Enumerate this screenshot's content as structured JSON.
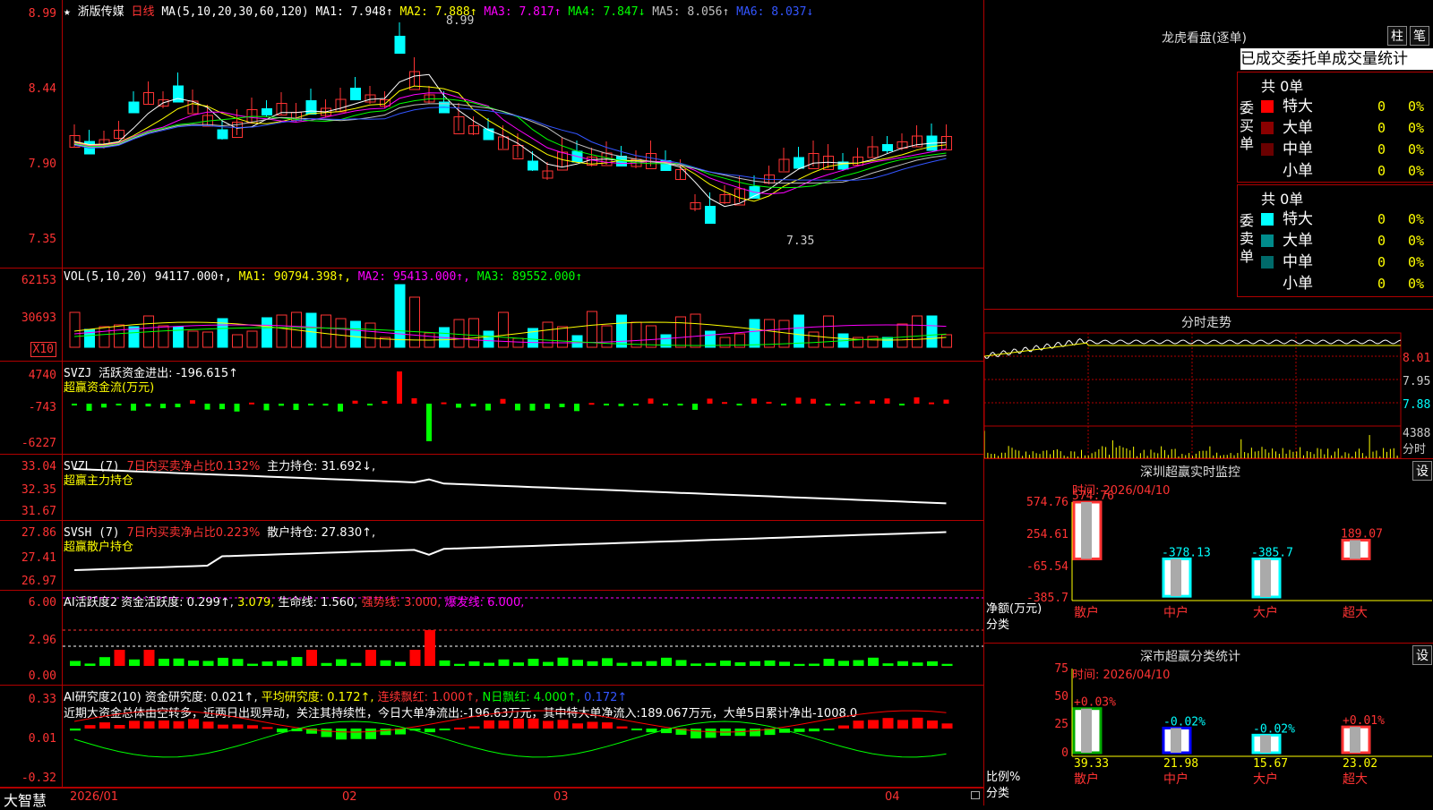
{
  "main": {
    "title_star": "★",
    "stock_name": "浙版传媒",
    "period": "日线",
    "ma_label": "MA(5,10,20,30,60,120)",
    "ma1": "MA1: 7.948↑",
    "ma2": "MA2: 7.888↑",
    "ma3": "MA3: 7.817↑",
    "ma4": "MA4: 7.847↓",
    "ma5": "MA5: 8.056↑",
    "ma6": "MA6: 8.037↓",
    "ticks": [
      "8.99",
      "8.44",
      "7.90",
      "7.35"
    ],
    "high_note": "8.99",
    "low_note": "7.35",
    "colors": {
      "ma1": "#ffffff",
      "ma2": "#ffff00",
      "ma3": "#ff00ff",
      "ma4": "#00ff00",
      "ma5": "#c0c0c0",
      "ma6": "#0000ff",
      "up": "#ff3333",
      "down": "#00ffff"
    }
  },
  "vol": {
    "label": "VOL(5,10,20)",
    "value": "94117.000↑,",
    "ma1": "MA1: 90794.398↑,",
    "ma2": "MA2: 95413.000↑,",
    "ma3": "MA3: 89552.000↑",
    "ticks": [
      "62153",
      "30693"
    ],
    "unit": "X10"
  },
  "svzj": {
    "label": "SVZJ",
    "active": "活跃资金进出: -196.615↑",
    "sub": "超赢资金流(万元)",
    "ticks": [
      "4740",
      "-743",
      "-6227"
    ]
  },
  "svzl": {
    "label": "SVZL (7)",
    "ratio": "7日内买卖净占比0.132%",
    "hold": "主力持仓: 31.692↓,",
    "sub": "超赢主力持仓",
    "ticks": [
      "33.04",
      "32.35",
      "31.67"
    ]
  },
  "svsh": {
    "label": "SVSH (7)",
    "ratio": "7日内买卖净占比0.223%",
    "hold": "散户持仓: 27.830↑,",
    "sub": "超赢散户持仓",
    "ticks": [
      "27.86",
      "27.41",
      "26.97"
    ]
  },
  "ai1": {
    "label": "AI活跃度2",
    "act": "资金活跃度: 0.299↑,",
    "v2": "3.079,",
    "life": "生命线: 1.560,",
    "strong": "强势线: 3.000,",
    "burst": "爆发线: 6.000,",
    "ticks": [
      "6.00",
      "2.96",
      "0.00"
    ]
  },
  "ai2": {
    "label": "AI研究度2(10)",
    "res": "资金研究度: 0.021↑,",
    "avg": "平均研究度: 0.172↑,",
    "cont": "连续飘红: 1.000↑,",
    "nday": "N日飘红: 4.000↑,",
    "last": "0.172↑",
    "comment": "近期大资金总体由空转多，近两日出现异动，关注其持续性，今日大单净流出:-196.63万元，其中特大单净流入:189.067万元，大单5日累计净出-1008.0",
    "ticks": [
      "0.33",
      "0.01",
      "-0.32"
    ]
  },
  "xaxis": {
    "logo": "大智慧",
    "labels": [
      "2026/01",
      "02",
      "03",
      "04"
    ]
  },
  "lhb": {
    "title": "龙虎看盘(逐单)",
    "btn1": "柱",
    "btn2": "笔",
    "tab_text": "已成交委托单成交量统计",
    "buy_label": "委买单",
    "sell_label": "委卖单",
    "buy_total": "共 0单",
    "sell_total": "共 0单",
    "buy_rows": [
      {
        "name": "特大",
        "n": "0",
        "p": "0%",
        "color": "#ff0000"
      },
      {
        "name": "大单",
        "n": "0",
        "p": "0%",
        "color": "#8b0000"
      },
      {
        "name": "中单",
        "n": "0",
        "p": "0%",
        "color": "#6a0000"
      },
      {
        "name": "小单",
        "n": "0",
        "p": "0%",
        "color": "#000000"
      }
    ],
    "sell_rows": [
      {
        "name": "特大",
        "n": "0",
        "p": "0%",
        "color": "#00ffff"
      },
      {
        "name": "大单",
        "n": "0",
        "p": "0%",
        "color": "#008b8b"
      },
      {
        "name": "中单",
        "n": "0",
        "p": "0%",
        "color": "#006a6a"
      },
      {
        "name": "小单",
        "n": "0",
        "p": "0%",
        "color": "#000000"
      }
    ]
  },
  "fenshi": {
    "title": "分时走势",
    "ticks": [
      "8.01",
      "7.95",
      "7.88"
    ],
    "vol_tick": "4388",
    "vol_unit": "分时"
  },
  "monitor": {
    "title": "深圳超赢实时监控",
    "btn": "设",
    "time": "时间: 2026/04/10",
    "yticks": [
      "574.76",
      "254.61",
      "-65.54",
      "-385.7"
    ],
    "ylabel": "净额(万元)",
    "xlabel": "分类",
    "cats": [
      "散户",
      "中户",
      "大户",
      "超大"
    ],
    "values": [
      574.76,
      -378.13,
      -385.7,
      189.07
    ],
    "value_labels": [
      "574.76",
      "-378.13",
      "-385.7",
      "189.07"
    ]
  },
  "classify": {
    "title": "深市超赢分类统计",
    "btn": "设",
    "time": "时间: 2026/04/10",
    "yticks": [
      "75",
      "50",
      "25",
      "0"
    ],
    "ylabel": "比例%",
    "xlabel": "分类",
    "cats": [
      "散户",
      "中户",
      "大户",
      "超大"
    ],
    "values": [
      39.33,
      21.98,
      15.67,
      23.02
    ],
    "value_labels": [
      "39.33",
      "21.98",
      "15.67",
      "23.02"
    ],
    "change_labels": [
      "+0.03%",
      "-0.02%",
      "-0.02%",
      "+0.01%"
    ]
  }
}
